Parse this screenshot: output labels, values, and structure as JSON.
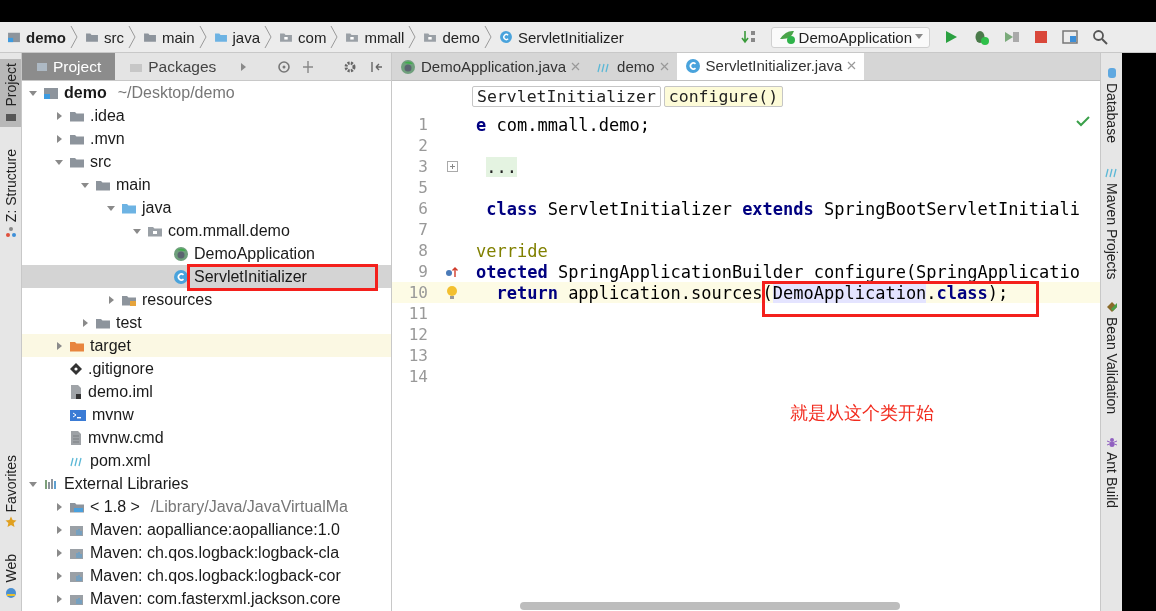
{
  "navigation_bar": {
    "breadcrumbs": [
      {
        "label": "demo",
        "kind": "module"
      },
      {
        "label": "src",
        "kind": "folder"
      },
      {
        "label": "main",
        "kind": "folder"
      },
      {
        "label": "java",
        "kind": "source-folder"
      },
      {
        "label": "com",
        "kind": "package"
      },
      {
        "label": "mmall",
        "kind": "package"
      },
      {
        "label": "demo",
        "kind": "package"
      },
      {
        "label": "ServletInitializer",
        "kind": "class"
      }
    ],
    "run_configuration": "DemoApplication"
  },
  "left_strip": {
    "top": [
      {
        "label": "Project",
        "kind": "project",
        "selected": true
      },
      {
        "label": "Z: Structure",
        "kind": "structure",
        "selected": false
      }
    ],
    "bottom": [
      {
        "label": "Favorites",
        "kind": "favorites",
        "selected": false
      },
      {
        "label": "Web",
        "kind": "web",
        "selected": false
      }
    ]
  },
  "project_panel": {
    "tabs": [
      {
        "label": "Project",
        "selected": true
      },
      {
        "label": "Packages",
        "selected": false
      }
    ],
    "tree": [
      {
        "label": "demo",
        "path": "~/Desktop/demo",
        "kind": "module",
        "expanded": true,
        "selected": false,
        "children": [
          {
            "label": ".idea",
            "kind": "folder",
            "expanded": false,
            "selected": false
          },
          {
            "label": ".mvn",
            "kind": "folder",
            "expanded": false,
            "selected": false
          },
          {
            "label": "src",
            "kind": "folder",
            "expanded": true,
            "selected": false,
            "children": [
              {
                "label": "main",
                "kind": "folder",
                "expanded": true,
                "selected": false,
                "children": [
                  {
                    "label": "java",
                    "kind": "source-folder",
                    "expanded": true,
                    "selected": false,
                    "children": [
                      {
                        "label": "com.mmall.demo",
                        "kind": "package",
                        "expanded": true,
                        "selected": false,
                        "children": [
                          {
                            "label": "DemoApplication",
                            "kind": "spring-class",
                            "selected": false
                          },
                          {
                            "label": "ServletInitializer",
                            "kind": "class",
                            "selected": true
                          }
                        ]
                      }
                    ]
                  },
                  {
                    "label": "resources",
                    "kind": "resource-folder",
                    "expanded": false,
                    "selected": false
                  }
                ]
              },
              {
                "label": "test",
                "kind": "folder",
                "expanded": false,
                "selected": false
              }
            ]
          },
          {
            "label": "target",
            "kind": "excluded-folder",
            "expanded": false,
            "selected": false
          },
          {
            "label": ".gitignore",
            "kind": "git",
            "selected": false
          },
          {
            "label": "demo.iml",
            "kind": "iml",
            "selected": false
          },
          {
            "label": "mvnw",
            "kind": "script",
            "selected": false
          },
          {
            "label": "mvnw.cmd",
            "kind": "file",
            "selected": false
          },
          {
            "label": "pom.xml",
            "kind": "maven",
            "selected": false
          }
        ]
      },
      {
        "label": "External Libraries",
        "kind": "libraries",
        "expanded": true,
        "selected": false,
        "children": [
          {
            "label": "< 1.8 >",
            "path": "/Library/Java/JavaVirtualMa",
            "kind": "jdk",
            "expanded": false,
            "selected": false
          },
          {
            "label": "Maven: aopalliance:aopalliance:1.0",
            "kind": "library",
            "expanded": false,
            "selected": false
          },
          {
            "label": "Maven: ch.qos.logback:logback-cla",
            "kind": "library",
            "expanded": false,
            "selected": false
          },
          {
            "label": "Maven: ch.qos.logback:logback-cor",
            "kind": "library",
            "expanded": false,
            "selected": false
          },
          {
            "label": "Maven: com.fasterxml.jackson.core",
            "kind": "library",
            "expanded": false,
            "selected": false
          }
        ]
      }
    ]
  },
  "editor": {
    "tabs": [
      {
        "label": "DemoApplication.java",
        "kind": "spring-class",
        "selected": false
      },
      {
        "label": "demo",
        "kind": "maven",
        "selected": false
      },
      {
        "label": "ServletInitializer.java",
        "kind": "class",
        "selected": true
      }
    ],
    "breadcrumbs": [
      {
        "label": "ServletInitializer",
        "selected": false
      },
      {
        "label": "configure()",
        "selected": true
      }
    ],
    "lines": [
      {
        "number": "1",
        "kind": "plain",
        "current": false,
        "segments": [
          {
            "kind": "keyword",
            "text": "e"
          },
          {
            "kind": "plain",
            "text": " com.mmall.demo;"
          }
        ]
      },
      {
        "number": "2",
        "kind": "plain",
        "current": false
      },
      {
        "number": "3",
        "kind": "fold",
        "current": false,
        "segments": [
          {
            "kind": "folded",
            "text": "..."
          }
        ]
      },
      {
        "number": "5",
        "kind": "plain",
        "current": false
      },
      {
        "number": "6",
        "kind": "plain",
        "current": false,
        "segments": [
          {
            "kind": "keyword",
            "text": " class"
          },
          {
            "kind": "plain",
            "text": " ServletInitializer "
          },
          {
            "kind": "keyword",
            "text": "extends"
          },
          {
            "kind": "plain",
            "text": " SpringBootServletInitiali"
          }
        ]
      },
      {
        "number": "7",
        "kind": "plain",
        "current": false
      },
      {
        "number": "8",
        "kind": "plain",
        "current": false,
        "segments": [
          {
            "kind": "annotation",
            "text": "verride"
          }
        ]
      },
      {
        "number": "9",
        "kind": "override",
        "current": false,
        "segments": [
          {
            "kind": "keyword",
            "text": "otected"
          },
          {
            "kind": "plain",
            "text": " SpringApplicationBuilder configure(SpringApplicatio"
          }
        ]
      },
      {
        "number": "10",
        "kind": "bulb",
        "current": true,
        "segments": [
          {
            "kind": "keyword",
            "text": "  return"
          },
          {
            "kind": "plain",
            "text": " application.sources("
          },
          {
            "kind": "usage",
            "text": "DemoApplication"
          },
          {
            "kind": "plain",
            "text": "."
          },
          {
            "kind": "keyword",
            "text": "class"
          },
          {
            "kind": "plain",
            "text": ");"
          }
        ]
      },
      {
        "number": "11",
        "kind": "plain",
        "current": false
      },
      {
        "number": "12",
        "kind": "plain",
        "current": false
      },
      {
        "number": "13",
        "kind": "plain",
        "current": false
      },
      {
        "number": "14",
        "kind": "plain",
        "current": false
      }
    ],
    "note": "就是从这个类开始"
  },
  "right_strip": [
    {
      "label": "Database",
      "kind": "database"
    },
    {
      "label": "Maven Projects",
      "kind": "maven"
    },
    {
      "label": "Bean Validation",
      "kind": "bean"
    },
    {
      "label": "Ant Build",
      "kind": "ant"
    }
  ]
}
